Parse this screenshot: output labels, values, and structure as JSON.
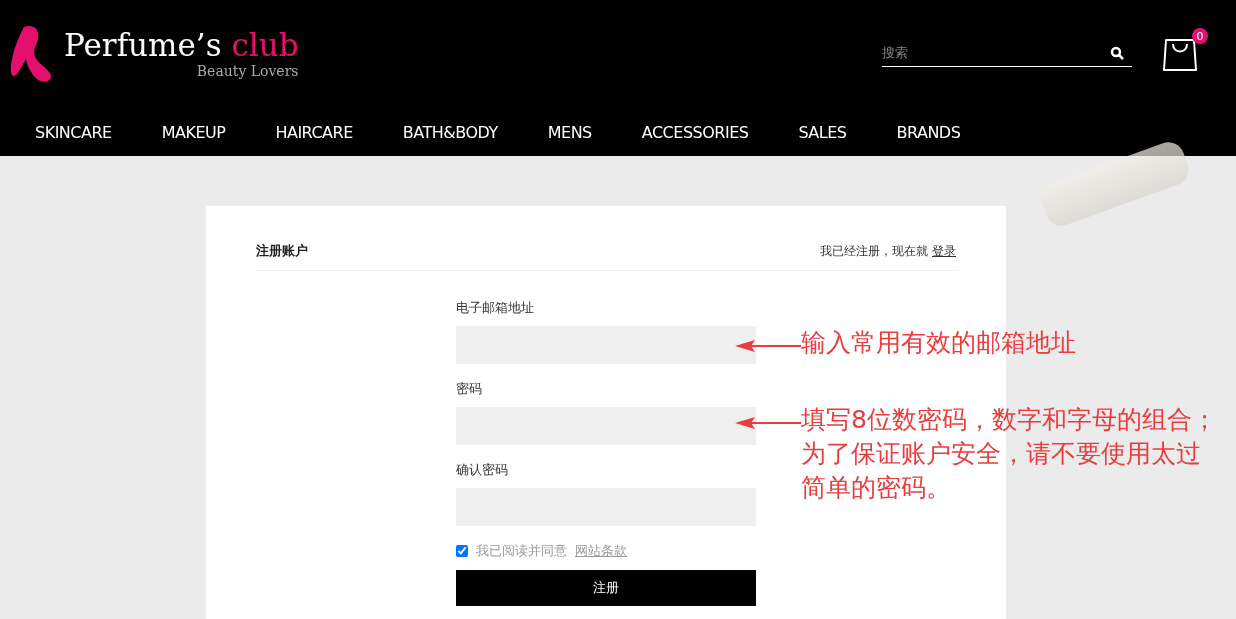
{
  "header": {
    "logo": {
      "name": "Perfume’s",
      "accent": "club",
      "tagline": "Beauty Lovers"
    },
    "search": {
      "placeholder": "搜索"
    },
    "cart": {
      "count": "0"
    }
  },
  "nav": [
    "SKINCARE",
    "MAKEUP",
    "HAIRCARE",
    "BATH&BODY",
    "MENS",
    "ACCESSORIES",
    "SALES",
    "BRANDS"
  ],
  "form": {
    "title": "注册账户",
    "login_prompt": "我已经注册，现在就",
    "login_link": "登录",
    "fields": [
      {
        "label": "电子邮箱地址"
      },
      {
        "label": "密码"
      },
      {
        "label": "确认密码"
      }
    ],
    "agree": {
      "checked": true,
      "label": "我已阅读并同意",
      "link": "网站条款"
    },
    "submit": "注册"
  },
  "annotations": [
    {
      "text": "输入常用有效的邮箱地址"
    },
    {
      "text": "填写8位数密码，数字和字母的组合；为了保证账户安全，请不要使用太过简单的密码。"
    }
  ]
}
